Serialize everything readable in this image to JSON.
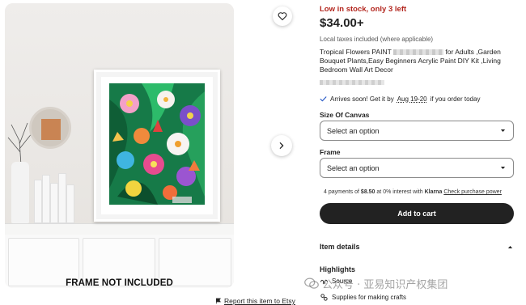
{
  "product_image": {
    "overlay_text": "FRAME NOT INCLUDED"
  },
  "stock_notice": "Low in stock, only 3 left",
  "price": "$34.00+",
  "tax_note": "Local taxes included (where applicable)",
  "title": {
    "part1": "Tropical Flowers PAINT",
    "part2": "for Adults ,Garden Bouquet Plants,Easy Beginners Acrylic Paint DIY Kit ,Living Bedroom Wall Art Decor"
  },
  "delivery": {
    "prefix": "Arrives soon! Get it by",
    "date": "Aug 19-20",
    "suffix": "if you order today"
  },
  "options": [
    {
      "label": "Size Of Canvas",
      "value": "Select an option"
    },
    {
      "label": "Frame",
      "value": "Select an option"
    }
  ],
  "klarna": {
    "prefix": "4 payments of",
    "amount": "$8.50",
    "middle": "at 0% interest with",
    "brand": "Klarna",
    "link": "Check purchase power"
  },
  "add_to_cart": "Add to cart",
  "item_details": "Item details",
  "highlights": {
    "heading": "Highlights",
    "items": [
      "Source",
      "Supplies for making crafts"
    ]
  },
  "report_link": "Report this item to Etsy",
  "watermark": "公众号 · 亚易知识产权集团",
  "colors": {
    "stock_red": "#b3261e",
    "button_dark": "#222222"
  }
}
